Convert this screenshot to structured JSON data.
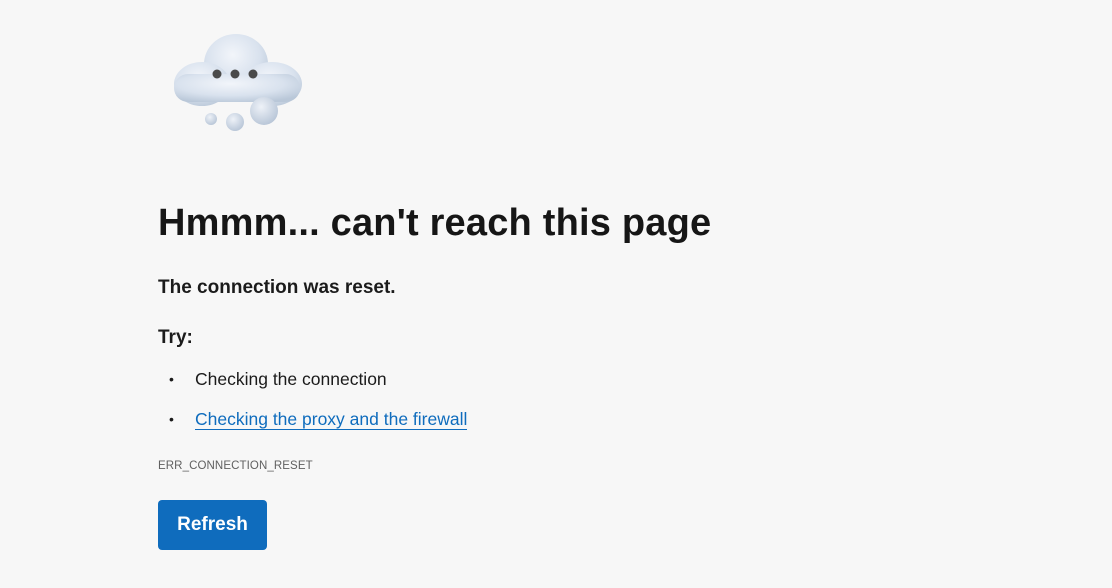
{
  "error_page": {
    "headline": "Hmmm... can't reach this page",
    "subtitle": "The connection was reset.",
    "try_label": "Try:",
    "suggestions": [
      {
        "text": "Checking the connection",
        "is_link": false
      },
      {
        "text": "Checking the proxy and the firewall",
        "is_link": true
      }
    ],
    "error_code": "ERR_CONNECTION_RESET",
    "refresh_label": "Refresh"
  },
  "icons": {
    "illustration": "cloud-ellipsis-icon"
  },
  "colors": {
    "background": "#f7f7f7",
    "accent": "#0f6cbd",
    "text": "#1b1b1b",
    "muted": "#606060"
  }
}
